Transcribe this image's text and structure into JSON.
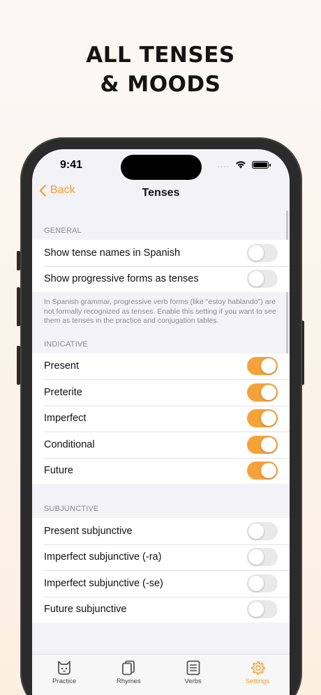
{
  "headline": {
    "line1": "ALL TENSES",
    "line2": "& MOODS"
  },
  "status_bar": {
    "time": "9:41",
    "signal_dots": "....",
    "wifi_icon": "wifi-icon",
    "battery_icon": "battery-icon"
  },
  "nav": {
    "back_label": "Back",
    "title": "Tenses"
  },
  "sections": {
    "general": {
      "header": "GENERAL",
      "rows": [
        {
          "label": "Show tense names in Spanish",
          "on": false
        },
        {
          "label": "Show progressive forms as tenses",
          "on": false
        }
      ],
      "footnote": "In Spanish grammar, progressive verb forms (like \"estoy hablando\") are not formally recognized as tenses. Enable this setting if you want to see them as tenses in the practice and conjugation tables."
    },
    "indicative": {
      "header": "INDICATIVE",
      "rows": [
        {
          "label": "Present",
          "on": true
        },
        {
          "label": "Preterite",
          "on": true
        },
        {
          "label": "Imperfect",
          "on": true
        },
        {
          "label": "Conditional",
          "on": true
        },
        {
          "label": "Future",
          "on": true
        }
      ]
    },
    "subjunctive": {
      "header": "SUBJUNCTIVE",
      "rows": [
        {
          "label": "Present subjunctive",
          "on": false
        },
        {
          "label": "Imperfect subjunctive (-ra)",
          "on": false
        },
        {
          "label": "Imperfect subjunctive (-se)",
          "on": false
        },
        {
          "label": "Future subjunctive",
          "on": false
        }
      ]
    }
  },
  "tabbar": {
    "tabs": [
      {
        "label": "Practice",
        "icon": "cat-icon",
        "active": false
      },
      {
        "label": "Rhymes",
        "icon": "cards-icon",
        "active": false
      },
      {
        "label": "Verbs",
        "icon": "list-icon",
        "active": false
      },
      {
        "label": "Settings",
        "icon": "gear-icon",
        "active": true
      }
    ]
  },
  "colors": {
    "accent": "#f39c2e",
    "toggle_on": "#f6a23a",
    "toggle_off": "#e9e9ea",
    "grouped_bg": "#f2f2f7"
  }
}
